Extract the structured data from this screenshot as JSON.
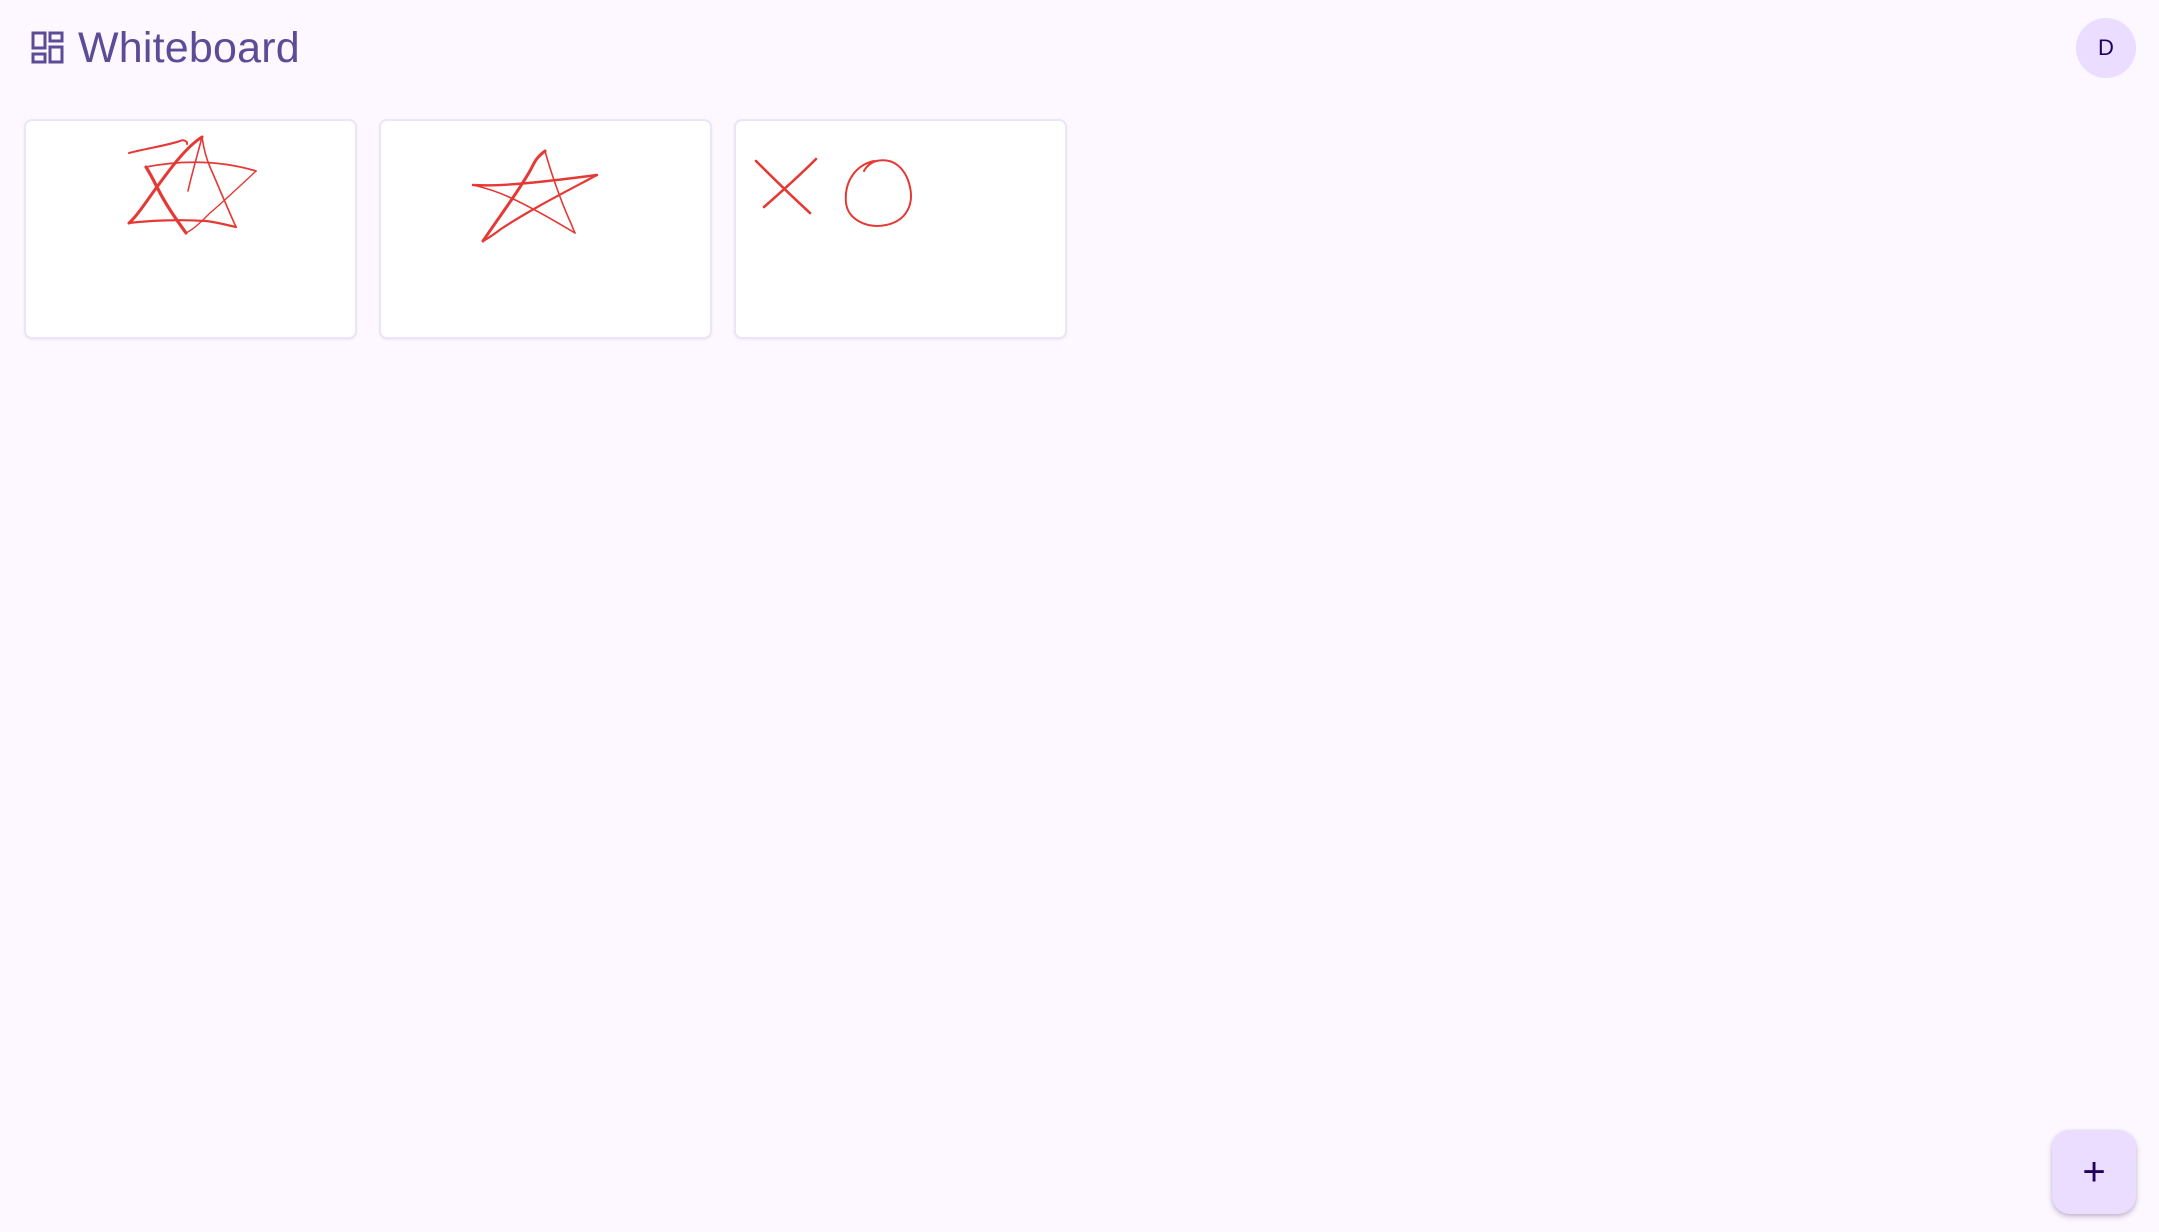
{
  "app_bar": {
    "title": "Whiteboard",
    "menu_icon": "dashboard-icon",
    "avatar_initial": "D"
  },
  "boards": [
    {
      "thumbnail": "star-sketch"
    },
    {
      "thumbnail": "star-sketch"
    },
    {
      "thumbnail": "x-and-circle-sketch"
    }
  ],
  "fab": {
    "icon": "plus-icon",
    "symbol": "+"
  },
  "colors": {
    "background": "#fdf7ff",
    "title": "#5a4c96",
    "avatar_bg": "#eaddff",
    "fab_bg": "#eaddff",
    "stroke": "#e53935"
  }
}
